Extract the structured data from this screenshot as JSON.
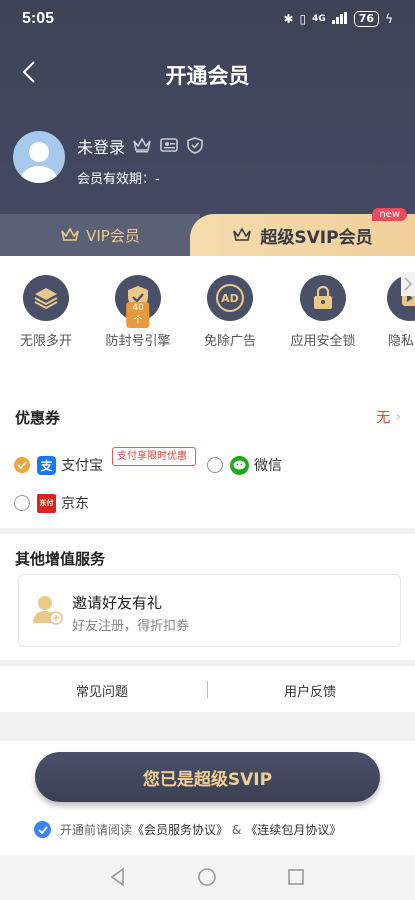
{
  "status_bar": {
    "time": "5:05",
    "network": "4G",
    "battery": "76"
  },
  "nav": {
    "title": "开通会员"
  },
  "user": {
    "name": "未登录",
    "validity": "会员有效期：-"
  },
  "tabs": [
    {
      "label": "VIP会员",
      "active": false
    },
    {
      "label": "超级SVIP会员",
      "active": true,
      "badge": "new"
    }
  ],
  "features": [
    {
      "label": "无限多开",
      "icon": "layers-icon"
    },
    {
      "label": "防封号引擎",
      "icon": "shield-check-icon",
      "tag": "40个"
    },
    {
      "label": "免除广告",
      "icon": "no-ad-icon",
      "icon_text": "AD"
    },
    {
      "label": "应用安全锁",
      "icon": "lock-icon"
    },
    {
      "label": "隐私",
      "icon": "privacy-icon"
    }
  ],
  "coupon": {
    "title": "优惠券",
    "value": "无"
  },
  "payment": {
    "methods": [
      {
        "label": "支付宝",
        "selected": true,
        "icon_text": "支"
      },
      {
        "label": "微信",
        "selected": false
      },
      {
        "label": "京东",
        "selected": false,
        "icon_text": "东付"
      }
    ],
    "promo_tag": "支付享限时优惠"
  },
  "other_services": {
    "title": "其他增值服务",
    "invite_title": "邀请好友有礼",
    "invite_subtitle": "好友注册，得折扣券"
  },
  "links": {
    "faq": "常见问题",
    "feedback": "用户反馈"
  },
  "cta": {
    "label": "您已是超级SVIP"
  },
  "agreement": {
    "prefix": "开通前请阅读",
    "doc1": "《会员服务协议》",
    "sep": "&",
    "doc2": "《连续包月协议》"
  },
  "colors": {
    "header": "#434a63",
    "gold": "#f1d09a",
    "accent_red": "#e6413f",
    "selected": "#f0a537",
    "check": "#3b82f6"
  }
}
